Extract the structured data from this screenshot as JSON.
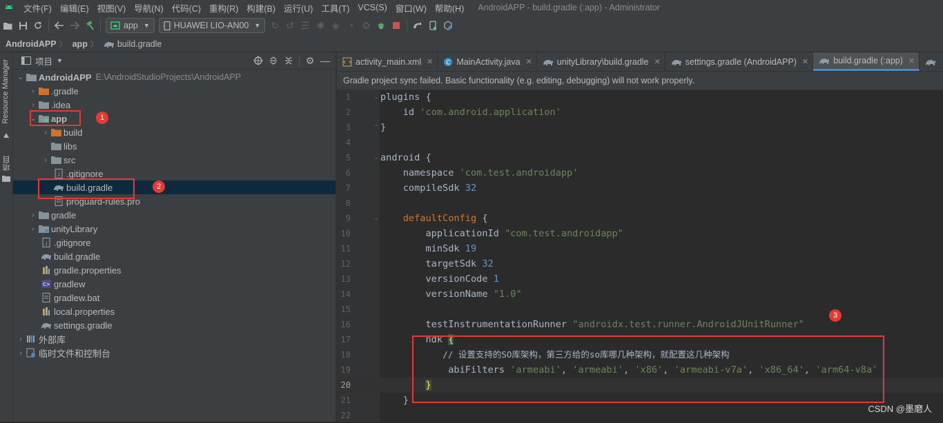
{
  "menu": {
    "items": [
      "文件(F)",
      "编辑(E)",
      "视图(V)",
      "导航(N)",
      "代码(C)",
      "重构(R)",
      "构建(B)",
      "运行(U)",
      "工具(T)",
      "VCS(S)",
      "窗口(W)",
      "帮助(H)"
    ],
    "window_title": "AndroidAPP - build.gradle (:app) - Administrator"
  },
  "toolbar": {
    "run_config": "app",
    "device": "HUAWEI LIO-AN00"
  },
  "breadcrumb": {
    "project": "AndroidAPP",
    "module": "app",
    "file": "build.gradle"
  },
  "side_strip": {
    "resource_manager": "Resource Manager",
    "project_tab": "项目"
  },
  "project_panel": {
    "title": "项目",
    "tree": [
      {
        "label": "AndroidAPP",
        "path": "E:\\AndroidStudioProjects\\AndroidAPP"
      },
      {
        "label": ".gradle"
      },
      {
        "label": ".idea"
      },
      {
        "label": "app"
      },
      {
        "label": "build"
      },
      {
        "label": "libs"
      },
      {
        "label": "src"
      },
      {
        "label": ".gitignore"
      },
      {
        "label": "build.gradle"
      },
      {
        "label": "proguard-rules.pro"
      },
      {
        "label": "gradle"
      },
      {
        "label": "unityLibrary"
      },
      {
        "label": ".gitignore"
      },
      {
        "label": "build.gradle"
      },
      {
        "label": "gradle.properties"
      },
      {
        "label": "gradlew"
      },
      {
        "label": "gradlew.bat"
      },
      {
        "label": "local.properties"
      },
      {
        "label": "settings.gradle"
      },
      {
        "label": "外部库"
      },
      {
        "label": "临时文件和控制台"
      }
    ]
  },
  "annotations": [
    "1",
    "2",
    "3"
  ],
  "editor": {
    "tabs": [
      {
        "label": "activity_main.xml"
      },
      {
        "label": "MainActivity.java"
      },
      {
        "label": "unityLibrary\\build.gradle"
      },
      {
        "label": "settings.gradle (AndroidAPP)"
      },
      {
        "label": "build.gradle (:app)"
      }
    ],
    "banner": "Gradle project sync failed. Basic functionality (e.g. editing, debugging) will not work properly.",
    "line_numbers": [
      "1",
      "2",
      "3",
      "4",
      "5",
      "6",
      "7",
      "8",
      "9",
      "10",
      "11",
      "12",
      "13",
      "14",
      "15",
      "16",
      "17",
      "18",
      "19",
      "20",
      "21",
      "22"
    ],
    "code": {
      "l1": "plugins {",
      "l2a": "    id ",
      "l2b": "'com.android.application'",
      "l3": "}",
      "l5": "android {",
      "l6a": "    namespace ",
      "l6b": "'com.test.androidapp'",
      "l7a": "    compileSdk ",
      "l7b": "32",
      "l9a": "    ",
      "l9b": "defaultConfig",
      "l9c": " {",
      "l10a": "        applicationId ",
      "l10b": "\"com.test.androidapp\"",
      "l11a": "        minSdk ",
      "l11b": "19",
      "l12a": "        targetSdk ",
      "l12b": "32",
      "l13a": "        versionCode ",
      "l13b": "1",
      "l14a": "        versionName ",
      "l14b": "\"1.0\"",
      "l16a": "        testInstrumentationRunner ",
      "l16b": "\"androidx.test.runner.AndroidJUnitRunner\"",
      "l17a": "        ndk ",
      "l17b": "{",
      "l18": "            // 设置支持的SO库架构，第三方给的so库哪几种架构，就配置这几种架构",
      "l19a": "            abiFilters ",
      "l19b": "'armeabi'",
      "l19c": ", ",
      "l19d": "'armeabi'",
      "l19e": ", ",
      "l19f": "'x86'",
      "l19g": ", ",
      "l19h": "'armeabi-v7a'",
      "l19i": ", ",
      "l19j": "'x86_64'",
      "l19k": ", ",
      "l19l": "'arm64-v8a'",
      "l20a": "        ",
      "l20b": "}",
      "l21": "    }"
    }
  },
  "watermark": "CSDN @墨磨人",
  "colors": {
    "accent": "#4a88c7",
    "annotation_red": "#e53935",
    "string_green": "#6a8759",
    "number_blue": "#6897bb",
    "keyword_orange": "#cc7832"
  }
}
